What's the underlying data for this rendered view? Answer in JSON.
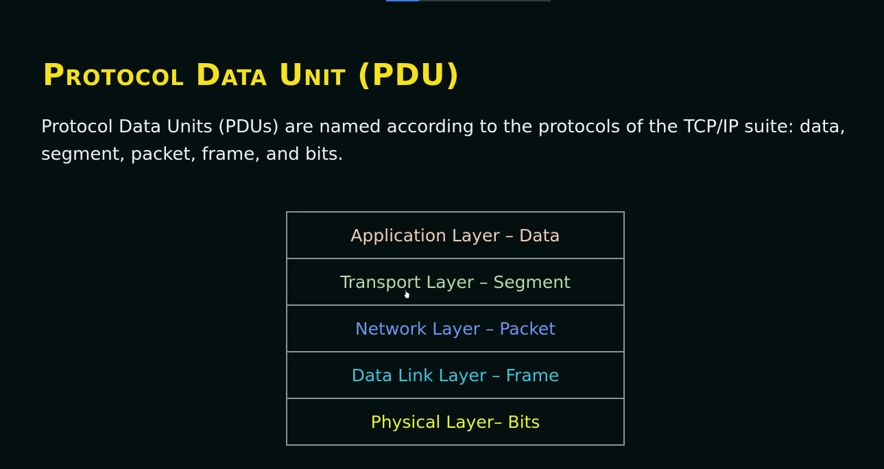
{
  "slide": {
    "title": "Protocol Data Unit (PDU)",
    "description": "Protocol Data Units (PDUs) are named according to the protocols of the TCP/IP suite: data, segment, packet, frame, and bits."
  },
  "layers": [
    {
      "label": "Application Layer – Data",
      "color": "#f1c9bf"
    },
    {
      "label": "Transport Layer – Segment",
      "color": "#b7d8a9"
    },
    {
      "label": "Network Layer – Packet",
      "color": "#6f94ee"
    },
    {
      "label": "Data Link Layer – Frame",
      "color": "#3fc4dd"
    },
    {
      "label": "Physical Layer– Bits",
      "color": "#e6f33a"
    }
  ],
  "colors": {
    "background": "#03100f",
    "title": "#f5e21c",
    "text": "#eef1f1",
    "table_border": "#8c9394",
    "progress_accent": "#3b82f6"
  },
  "cursor": {
    "icon": "pointer-hand-icon"
  }
}
